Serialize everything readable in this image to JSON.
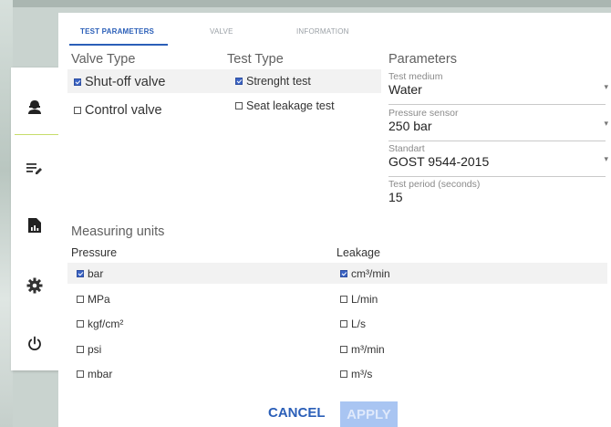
{
  "tabs": {
    "test_parameters": "TEST PARAMETERS",
    "valve": "VALVE",
    "information": "INFORMATION"
  },
  "valve_type": {
    "title": "Valve Type",
    "options": [
      {
        "label": "Shut-off valve",
        "checked": true
      },
      {
        "label": "Control valve",
        "checked": false
      }
    ]
  },
  "test_type": {
    "title": "Test Type",
    "options": [
      {
        "label": "Strenght test",
        "checked": true
      },
      {
        "label": "Seat leakage test",
        "checked": false
      }
    ]
  },
  "parameters": {
    "title": "Parameters",
    "test_medium": {
      "label": "Test medium",
      "value": "Water"
    },
    "pressure_sensor": {
      "label": "Pressure sensor",
      "value": "250 bar"
    },
    "standart": {
      "label": "Standart",
      "value": "GOST 9544-2015"
    },
    "test_period": {
      "label": "Test period (seconds)",
      "value": "15"
    }
  },
  "measuring_units": {
    "title": "Measuring units",
    "pressure": {
      "title": "Pressure",
      "options": [
        {
          "label": "bar",
          "checked": true
        },
        {
          "label": "MPa",
          "checked": false
        },
        {
          "label": "kgf/cm²",
          "checked": false
        },
        {
          "label": "psi",
          "checked": false
        },
        {
          "label": "mbar",
          "checked": false
        }
      ]
    },
    "leakage": {
      "title": "Leakage",
      "options": [
        {
          "label": "cm³/min",
          "checked": true
        },
        {
          "label": "L/min",
          "checked": false
        },
        {
          "label": "L/s",
          "checked": false
        },
        {
          "label": "m³/min",
          "checked": false
        },
        {
          "label": "m³/s",
          "checked": false
        }
      ]
    }
  },
  "actions": {
    "cancel": "CANCEL",
    "apply": "APPLY"
  },
  "sidebar": {
    "icons": [
      "worker-icon",
      "edit-list-icon",
      "report-icon",
      "gear-icon",
      "power-icon"
    ],
    "active_index": 0,
    "accent_color": "#c6dd6a"
  },
  "colors": {
    "primary": "#2b5fb8",
    "checkbox_checked": "#3b64c5",
    "apply_disabled": "#a9c5f2"
  }
}
